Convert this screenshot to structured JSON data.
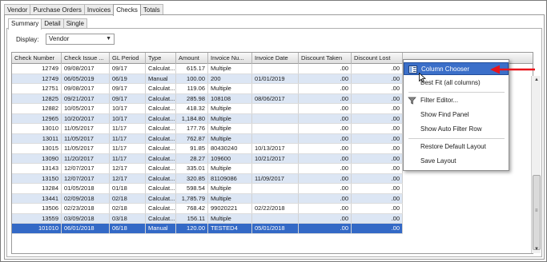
{
  "top_tabs": [
    "Vendor",
    "Purchase Orders",
    "Invoices",
    "Checks",
    "Totals"
  ],
  "top_tab_active": "Checks",
  "sub_tabs": [
    "Summary",
    "Detail",
    "Single"
  ],
  "sub_tab_active": "Summary",
  "display": {
    "label": "Display:",
    "value": "Vendor"
  },
  "columns": [
    "Check Number",
    "Check Issue ...",
    "GL Period",
    "Type",
    "Amount",
    "Invoice Nu...",
    "Invoice Date",
    "Discount Taken",
    "Discount Lost"
  ],
  "rows": [
    [
      "12749",
      "09/08/2017",
      "09/17",
      "Calculat...",
      "615.17",
      "Multiple",
      "",
      ".00",
      ".00"
    ],
    [
      "12749",
      "06/05/2019",
      "06/19",
      "Manual",
      "100.00",
      "200",
      "01/01/2019",
      ".00",
      ".00"
    ],
    [
      "12751",
      "09/08/2017",
      "09/17",
      "Calculat...",
      "119.06",
      "Multiple",
      "",
      ".00",
      ".00"
    ],
    [
      "12825",
      "09/21/2017",
      "09/17",
      "Calculat...",
      "285.98",
      "108108",
      "08/06/2017",
      ".00",
      ".00"
    ],
    [
      "12882",
      "10/05/2017",
      "10/17",
      "Calculat...",
      "418.32",
      "Multiple",
      "",
      ".00",
      ".00"
    ],
    [
      "12965",
      "10/20/2017",
      "10/17",
      "Calculat...",
      "1,184.80",
      "Multiple",
      "",
      ".00",
      ".00"
    ],
    [
      "13010",
      "11/05/2017",
      "11/17",
      "Calculat...",
      "177.76",
      "Multiple",
      "",
      ".00",
      ".00"
    ],
    [
      "13011",
      "11/05/2017",
      "11/17",
      "Calculat...",
      "762.87",
      "Multiple",
      "",
      ".00",
      ".00"
    ],
    [
      "13015",
      "11/05/2017",
      "11/17",
      "Calculat...",
      "91.85",
      "80430240",
      "10/13/2017",
      ".00",
      ".00"
    ],
    [
      "13090",
      "11/20/2017",
      "11/17",
      "Calculat...",
      "28.27",
      "109600",
      "10/21/2017",
      ".00",
      ".00"
    ],
    [
      "13143",
      "12/07/2017",
      "12/17",
      "Calculat...",
      "335.01",
      "Multiple",
      "",
      ".00",
      ".00"
    ],
    [
      "13150",
      "12/07/2017",
      "12/17",
      "Calculat...",
      "320.85",
      "81109086",
      "11/09/2017",
      ".00",
      ".00"
    ],
    [
      "13284",
      "01/05/2018",
      "01/18",
      "Calculat...",
      "598.54",
      "Multiple",
      "",
      ".00",
      ".00"
    ],
    [
      "13441",
      "02/09/2018",
      "02/18",
      "Calculat...",
      "1,785.79",
      "Multiple",
      "",
      ".00",
      ".00"
    ],
    [
      "13506",
      "02/23/2018",
      "02/18",
      "Calculat...",
      "768.42",
      "99020221",
      "02/22/2018",
      ".00",
      ".00"
    ],
    [
      "13559",
      "03/09/2018",
      "03/18",
      "Calculat...",
      "156.11",
      "Multiple",
      "",
      ".00",
      ".00"
    ],
    [
      "101010",
      "06/01/2018",
      "06/18",
      "Manual",
      "120.00",
      "TESTED4",
      "05/01/2018",
      ".00",
      ".00"
    ]
  ],
  "selected_row_index": 16,
  "context_menu": {
    "items": [
      {
        "label": "Column Chooser",
        "icon": "column-chooser-icon"
      },
      {
        "label": "Best Fit (all columns)",
        "icon": ""
      },
      {
        "label": "Filter Editor...",
        "icon": "filter-icon"
      },
      {
        "label": "Show Find Panel",
        "icon": ""
      },
      {
        "label": "Show Auto Filter Row",
        "icon": ""
      },
      {
        "label": "Restore Default Layout",
        "icon": ""
      },
      {
        "label": "Save Layout",
        "icon": ""
      }
    ],
    "highlighted": "Column Chooser"
  },
  "colors": {
    "selection": "#3369c6",
    "alt_row": "#dce6f4",
    "callout_arrow": "#e8141b",
    "menu_highlight": "#3b6fc9"
  }
}
